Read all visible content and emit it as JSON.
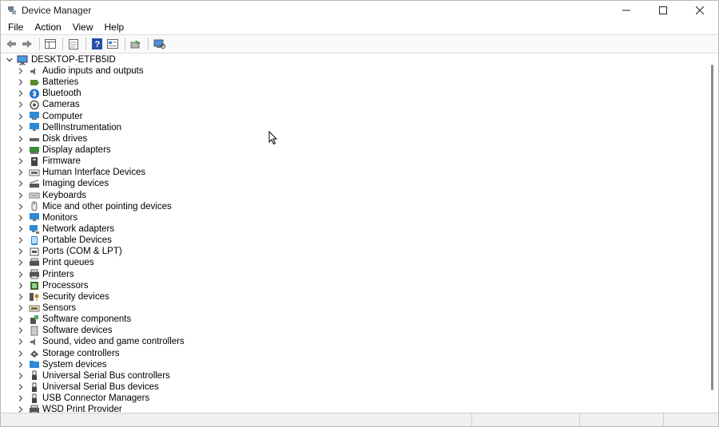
{
  "window": {
    "title": "Device Manager",
    "minimize": "—",
    "maximize": "☐",
    "close": "✕"
  },
  "menu": [
    {
      "label": "File"
    },
    {
      "label": "Action"
    },
    {
      "label": "View"
    },
    {
      "label": "Help"
    }
  ],
  "toolbar": {
    "buttons": [
      {
        "name": "back-icon"
      },
      {
        "name": "forward-icon"
      },
      {
        "name": "show-hide-tree-icon"
      },
      {
        "name": "properties-icon"
      },
      {
        "name": "help-icon"
      },
      {
        "name": "view-by-icon"
      },
      {
        "name": "update-driver-icon"
      },
      {
        "name": "scan-hardware-icon"
      }
    ]
  },
  "tree": {
    "root": "DESKTOP-ETFB5ID",
    "items": [
      {
        "label": "Audio inputs and outputs",
        "icon": "speaker-icon",
        "color": "#6b6b6b"
      },
      {
        "label": "Batteries",
        "icon": "battery-icon",
        "color": "#5a8a2a"
      },
      {
        "label": "Bluetooth",
        "icon": "bluetooth-icon",
        "color": "#1f6fd1"
      },
      {
        "label": "Cameras",
        "icon": "camera-icon",
        "color": "#555555"
      },
      {
        "label": "Computer",
        "icon": "computer-icon",
        "color": "#2c8ad6"
      },
      {
        "label": "DellInstrumentation",
        "icon": "monitor-icon",
        "color": "#2c8ad6"
      },
      {
        "label": "Disk drives",
        "icon": "disk-icon",
        "color": "#666666"
      },
      {
        "label": "Display adapters",
        "icon": "display-adapter-icon",
        "color": "#3a8a3a"
      },
      {
        "label": "Firmware",
        "icon": "firmware-icon",
        "color": "#444444"
      },
      {
        "label": "Human Interface Devices",
        "icon": "hid-icon",
        "color": "#666666"
      },
      {
        "label": "Imaging devices",
        "icon": "scanner-icon",
        "color": "#555555"
      },
      {
        "label": "Keyboards",
        "icon": "keyboard-icon",
        "color": "#777777"
      },
      {
        "label": "Mice and other pointing devices",
        "icon": "mouse-icon",
        "color": "#666666"
      },
      {
        "label": "Monitors",
        "icon": "monitor-icon",
        "color": "#2c8ad6"
      },
      {
        "label": "Network adapters",
        "icon": "network-icon",
        "color": "#2c8ad6"
      },
      {
        "label": "Portable Devices",
        "icon": "portable-device-icon",
        "color": "#2c8ad6"
      },
      {
        "label": "Ports (COM & LPT)",
        "icon": "port-icon",
        "color": "#555555"
      },
      {
        "label": "Print queues",
        "icon": "print-queue-icon",
        "color": "#555555"
      },
      {
        "label": "Printers",
        "icon": "printer-icon",
        "color": "#555555"
      },
      {
        "label": "Processors",
        "icon": "processor-icon",
        "color": "#3a6a2a"
      },
      {
        "label": "Security devices",
        "icon": "security-key-icon",
        "color": "#b08a20"
      },
      {
        "label": "Sensors",
        "icon": "sensor-icon",
        "color": "#7a6a3a"
      },
      {
        "label": "Software components",
        "icon": "software-component-icon",
        "color": "#555555"
      },
      {
        "label": "Software devices",
        "icon": "software-device-icon",
        "color": "#777777"
      },
      {
        "label": "Sound, video and game controllers",
        "icon": "speaker-icon",
        "color": "#6b6b6b"
      },
      {
        "label": "Storage controllers",
        "icon": "storage-controller-icon",
        "color": "#555555"
      },
      {
        "label": "System devices",
        "icon": "system-folder-icon",
        "color": "#2c8ad6"
      },
      {
        "label": "Universal Serial Bus controllers",
        "icon": "usb-icon",
        "color": "#444444"
      },
      {
        "label": "Universal Serial Bus devices",
        "icon": "usb-icon",
        "color": "#444444"
      },
      {
        "label": "USB Connector Managers",
        "icon": "usb-icon",
        "color": "#444444"
      },
      {
        "label": "WSD Print Provider",
        "icon": "printer-icon",
        "color": "#555555"
      }
    ]
  }
}
